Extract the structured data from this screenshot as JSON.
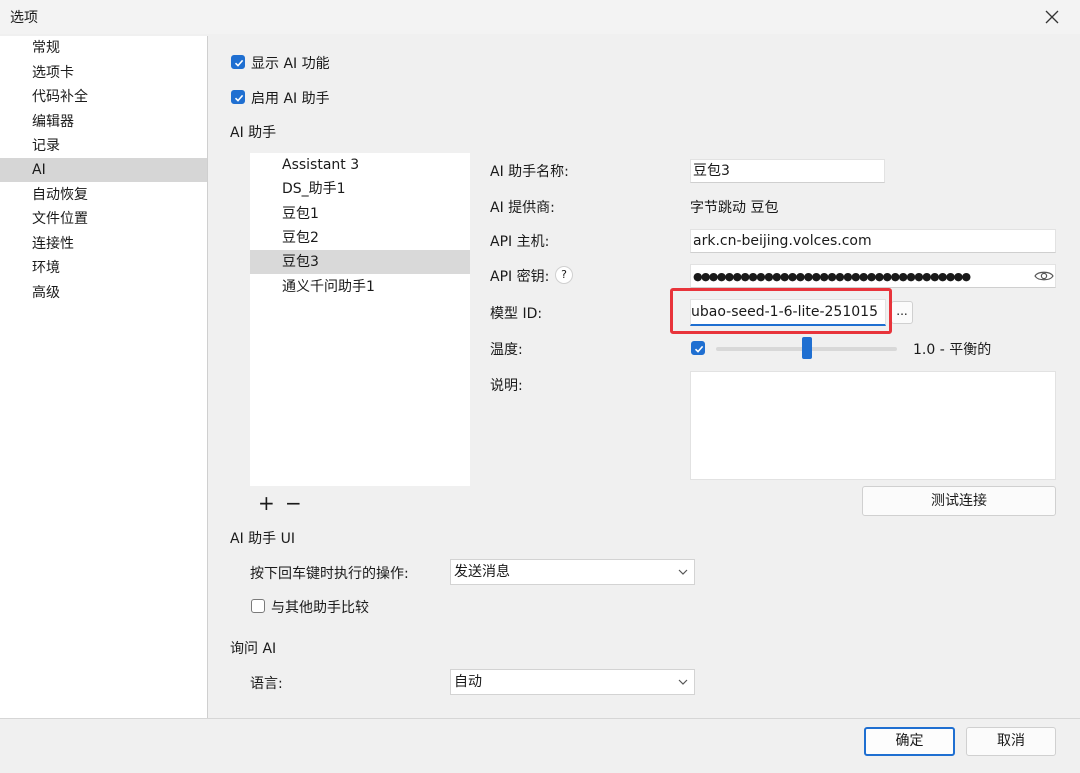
{
  "window": {
    "title": "选项"
  },
  "sidebar": {
    "items": [
      {
        "label": "常规"
      },
      {
        "label": "选项卡"
      },
      {
        "label": "代码补全"
      },
      {
        "label": "编辑器"
      },
      {
        "label": "记录"
      },
      {
        "label": "AI"
      },
      {
        "label": "自动恢复"
      },
      {
        "label": "文件位置"
      },
      {
        "label": "连接性"
      },
      {
        "label": "环境"
      },
      {
        "label": "高级"
      }
    ],
    "selected": "AI"
  },
  "main": {
    "show_ai_label": "显示 AI 功能",
    "enable_assistant_label": "启用 AI 助手",
    "assistant_section": "AI 助手",
    "assistants": [
      {
        "label": "Assistant 3"
      },
      {
        "label": "DS_助手1"
      },
      {
        "label": "豆包1"
      },
      {
        "label": "豆包2"
      },
      {
        "label": "豆包3"
      },
      {
        "label": "通义千问助手1"
      }
    ],
    "selected_assistant": "豆包3",
    "add_symbol": "+",
    "remove_symbol": "−",
    "form": {
      "name_label": "AI 助手名称:",
      "name_value": "豆包3",
      "provider_label": "AI 提供商:",
      "provider_value": "字节跳动 豆包",
      "host_label": "API 主机:",
      "host_value": "ark.cn-beijing.volces.com",
      "key_label": "API 密钥:",
      "key_help": "?",
      "key_value": "●●●●●●●●●●●●●●●●●●●●●●●●●●●●●●●●●●●",
      "model_label": "模型 ID:",
      "model_value": "ubao-seed-1-6-lite-251015",
      "model_browse": "...",
      "temperature_label": "温度:",
      "temperature_level": 0.5,
      "temperature_value": "1.0 - 平衡的",
      "description_label": "说明:",
      "test_button": "测试连接"
    },
    "ui_section": "AI 助手 UI",
    "enter_action_label": "按下回车键时执行的操作:",
    "enter_action_value": "发送消息",
    "compare_label": "与其他助手比较",
    "ask_section": "询问 AI",
    "language_label": "语言:",
    "language_value": "自动"
  },
  "footer": {
    "ok_label": "确定",
    "cancel_label": "取消"
  },
  "colors": {
    "accent": "#1f6fd1",
    "highlight_border": "#e8343b"
  }
}
